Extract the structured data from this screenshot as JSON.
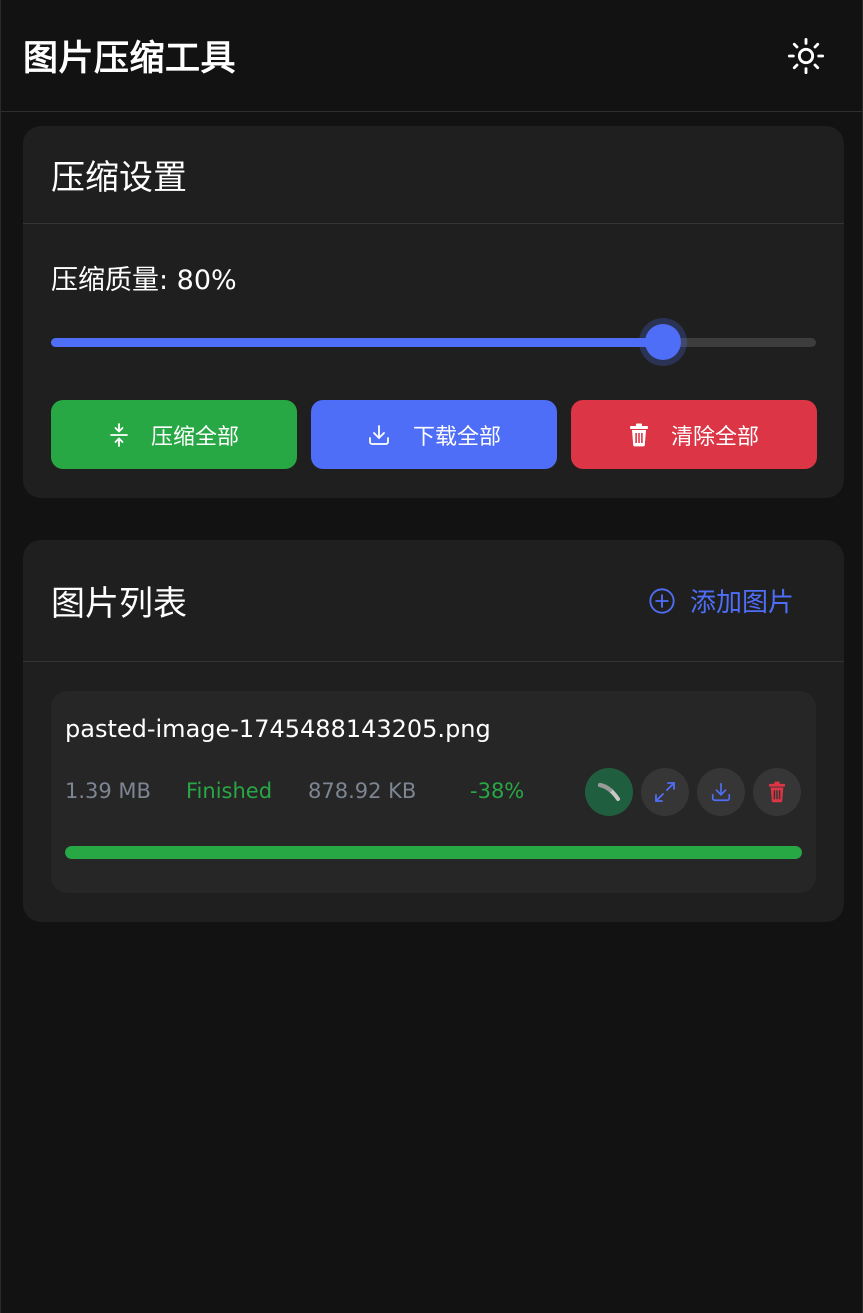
{
  "header": {
    "title": "图片压缩工具",
    "theme_icon": "sun-icon"
  },
  "settings": {
    "title": "压缩设置",
    "quality_label": "压缩质量: 80%",
    "quality_value": 0.8,
    "buttons": {
      "compress_all": "压缩全部",
      "download_all": "下载全部",
      "clear_all": "清除全部"
    }
  },
  "image_list": {
    "title": "图片列表",
    "add_label": "添加图片",
    "items": [
      {
        "name": "pasted-image-1745488143205.png",
        "original_size": "1.39 MB",
        "status": "Finished",
        "compressed_size": "878.92 KB",
        "ratio": "-38%",
        "progress": 1.0
      }
    ]
  },
  "colors": {
    "accent": "#4f6ef7",
    "success": "#28a745",
    "danger": "#dc3545",
    "background": "#121212",
    "card": "#1f1f1f"
  }
}
